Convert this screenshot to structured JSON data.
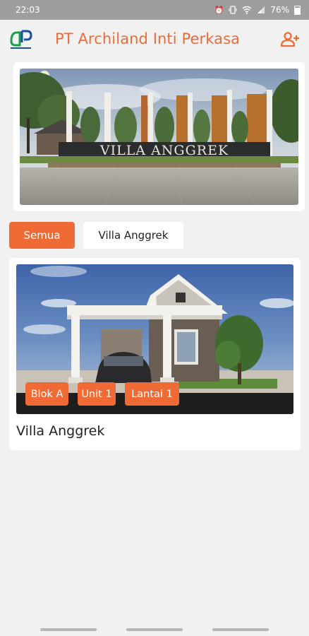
{
  "status_bar": {
    "time": "22:03",
    "battery": "76%",
    "icons": [
      "alarm-icon",
      "vibrate-icon",
      "wifi-icon",
      "signal-icon",
      "battery-icon"
    ]
  },
  "app_bar": {
    "title": "PT Archiland Inti Perkasa",
    "add_user_icon": "add-user-icon",
    "accent_color": "#f06a35"
  },
  "banner": {
    "sign_text": "VILLA ANGGREK"
  },
  "filters": {
    "items": [
      {
        "label": "Semua",
        "selected": true
      },
      {
        "label": "Villa Anggrek",
        "selected": false
      }
    ]
  },
  "projects": [
    {
      "name": "Villa Anggrek",
      "tags": [
        "Blok A",
        "Unit 1",
        "Lantai 1"
      ]
    }
  ]
}
